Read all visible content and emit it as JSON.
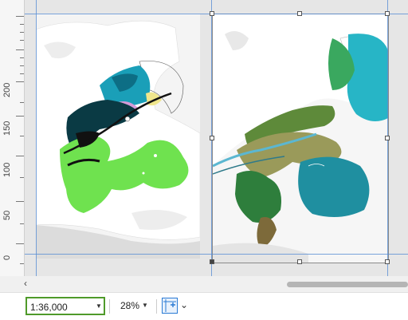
{
  "ruler": {
    "labels": [
      "200",
      "150",
      "100",
      "50",
      "0"
    ]
  },
  "status": {
    "scale": "1:36,000",
    "zoom": "28%"
  },
  "icons": {
    "scroll_left": "chevron-left-icon",
    "scale_dropdown": "caret-down-icon",
    "zoom_dropdown": "caret-down-icon",
    "snap": "snap-to-guides-icon",
    "snap_dropdown": "chevron-down-icon"
  },
  "colors": {
    "scale_highlight": "#4f9a2a",
    "guide": "#5a8fd4",
    "map_cyan": "#1a9fb8",
    "map_green": "#6fe24f"
  }
}
